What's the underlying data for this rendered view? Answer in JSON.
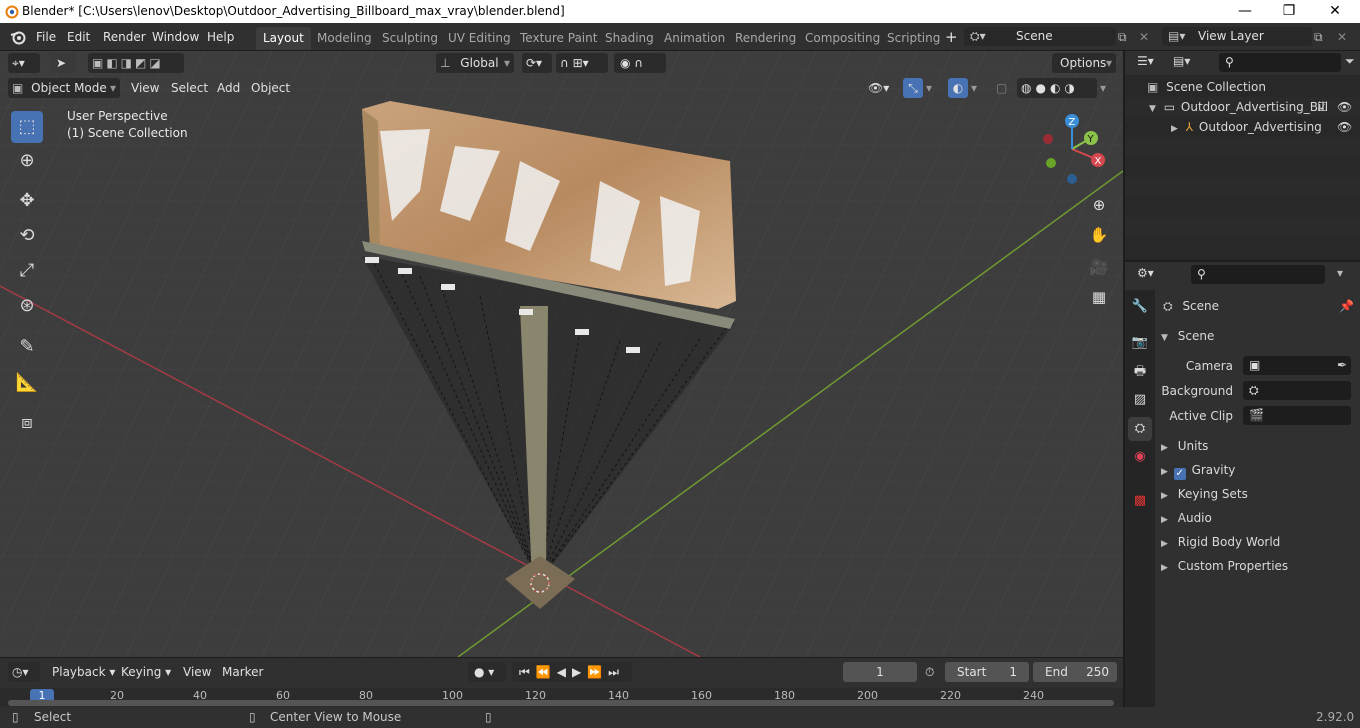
{
  "window": {
    "title": "Blender* [C:\\Users\\lenov\\Desktop\\Outdoor_Advertising_Billboard_max_vray\\blender.blend]",
    "minimize": "—",
    "maximize": "❐",
    "close": "✕"
  },
  "menu": {
    "items": [
      "File",
      "Edit",
      "Render",
      "Window",
      "Help"
    ]
  },
  "workspaces": [
    "Layout",
    "Modeling",
    "Sculpting",
    "UV Editing",
    "Texture Paint",
    "Shading",
    "Animation",
    "Rendering",
    "Compositing",
    "Scripting"
  ],
  "scene_selector": {
    "value": "Scene"
  },
  "view_layer": {
    "value": "View Layer"
  },
  "viewport": {
    "mode": "Object Mode",
    "menus": [
      "View",
      "Select",
      "Add",
      "Object"
    ],
    "transform_orientation": "Global",
    "options_label": "Options",
    "overlay_text": {
      "perspective": "User Perspective",
      "collection": "(1) Scene Collection"
    },
    "gizmo_axes": {
      "x": "X",
      "y": "Y",
      "z": "Z"
    },
    "colors": {
      "x_axis": "#d4484f",
      "y_axis": "#8bc34a",
      "z_axis": "#3a8dd8",
      "bg": "#3d3d3d",
      "accent": "#4772b3"
    }
  },
  "tools": [
    "select-box",
    "cursor",
    "move",
    "rotate",
    "scale",
    "transform",
    "annotate",
    "measure",
    "add-cube"
  ],
  "timeline": {
    "menus": [
      "Playback",
      "Keying",
      "View",
      "Marker"
    ],
    "current_frame": "1",
    "start_label": "Start",
    "start": "1",
    "end_label": "End",
    "end": "250",
    "ruler": [
      "1",
      "20",
      "40",
      "60",
      "80",
      "100",
      "120",
      "140",
      "160",
      "180",
      "200",
      "220",
      "240"
    ]
  },
  "status": {
    "select": "Select",
    "center_view": "Center View to Mouse",
    "version": "2.92.0"
  },
  "outliner": {
    "root": "Scene Collection",
    "items": [
      {
        "label": "Outdoor_Advertising_Bill"
      },
      {
        "label": "Outdoor_Advertising"
      }
    ]
  },
  "properties": {
    "header": "Scene",
    "section": "Scene",
    "fields": [
      {
        "label": "Camera"
      },
      {
        "label": "Background ..."
      },
      {
        "label": "Active Clip"
      }
    ],
    "panels": [
      "Units",
      "Gravity",
      "Keying Sets",
      "Audio",
      "Rigid Body World",
      "Custom Properties"
    ]
  }
}
